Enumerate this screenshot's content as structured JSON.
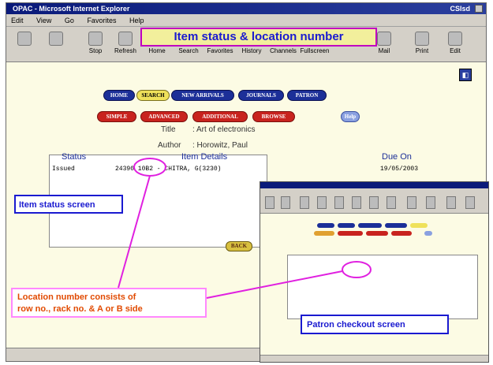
{
  "window": {
    "title": "OPAC - Microsoft Internet Explorer",
    "corner_label": "CSIsd",
    "menu": [
      "Edit",
      "View",
      "Go",
      "Favorites",
      "Help"
    ]
  },
  "toolbar": {
    "buttons": [
      "Stop",
      "Refresh",
      "Home",
      "Search",
      "Favorites",
      "History",
      "Channels",
      "Fullscreen",
      "Mail",
      "Print",
      "Edit"
    ]
  },
  "opac": {
    "nav_primary": [
      "HOME",
      "SEARCH",
      "NEW ARRIVALS",
      "JOURNALS",
      "PATRON"
    ],
    "nav_secondary": [
      "SIMPLE",
      "ADVANCED",
      "ADDITIONAL",
      "BROWSE"
    ],
    "help_label": "Help",
    "title_label": "Title",
    "title_value": ": Art of electronics",
    "author_label": "Author",
    "author_value": ": Horowitz, Paul",
    "table_headers": {
      "status": "Status",
      "details": "Item Details",
      "due": "Due On"
    },
    "rows": [
      {
        "status": "Issued",
        "details": "24390 10B2 - CHITRA, G(3230)",
        "due": "19/05/2003"
      }
    ],
    "back_label": "BACK"
  },
  "annotations": {
    "heading": "Item status & location number",
    "item_status": "Item status screen",
    "location_line1": "Location number consists of",
    "location_line2": "row no., rack no. & A or B side",
    "patron_checkout": "Patron checkout screen"
  },
  "colors": {
    "nav_blue": "#1c2f98",
    "nav_red": "#c8231e",
    "nav_yellow": "#efe15a",
    "callout_blue": "#1a1ad0",
    "callout_orange": "#e14a00",
    "highlight_magenta": "#e020e0"
  }
}
